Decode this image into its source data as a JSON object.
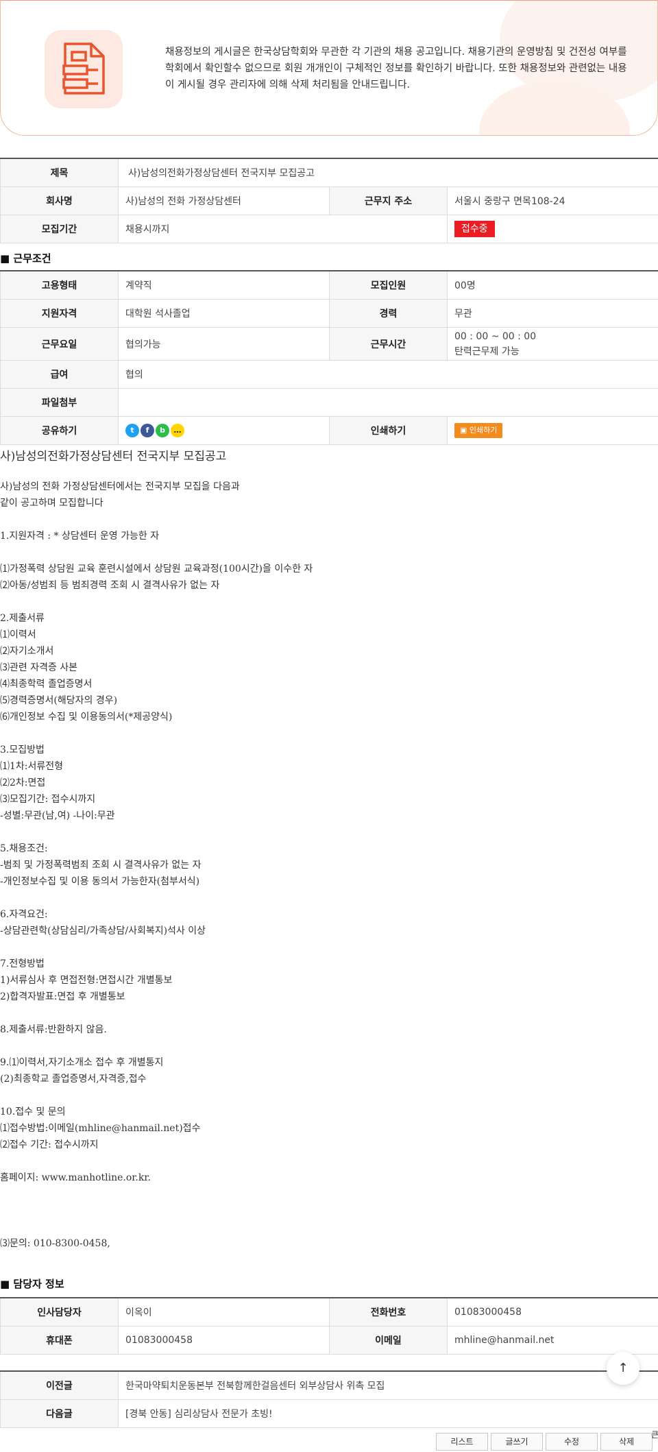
{
  "notice": {
    "text": "채용정보의 게시글은 한국상담학회와 무관한 각 기관의 채용 공고입니다. 채용기관의 운영방침 및 건전성 여부를 학회에서 확인할수 없으므로 회원 개개인이 구체적인 정보를 확인하기 바랍니다. 또한 채용정보와 관련없는 내용이 게시될 경우 관리자에 의해 삭제 처리됨을 안내드립니다.",
    "icon": "document-icon"
  },
  "info": {
    "title_label": "제목",
    "title_value": "사)남성의전화가정상담센터 전국지부 모집공고",
    "company_label": "회사명",
    "company_value": "사)남성의 전화 가정상담센터",
    "address_label": "근무지 주소",
    "address_value": "서울시 중랑구 면목108-24",
    "period_label": "모집기간",
    "period_value": "채용시까지",
    "status_badge": "접수중"
  },
  "conditions": {
    "heading": "■ 근무조건",
    "employment_label": "고용형태",
    "employment_value": "계약직",
    "headcount_label": "모집인원",
    "headcount_value": "00명",
    "qualification_label": "지원자격",
    "qualification_value": "대학원 석사졸업",
    "career_label": "경력",
    "career_value": "무관",
    "workday_label": "근무요일",
    "workday_value": "협의가능",
    "worktime_label": "근무시간",
    "worktime_value1": "00 : 00 ~ 00 : 00",
    "worktime_value2": "탄력근무제 가능",
    "salary_label": "급여",
    "salary_value": "협의",
    "attach_label": "파일첨부",
    "share_label": "공유하기",
    "print_label": "인쇄하기",
    "print_button": "인쇄하기",
    "share_icons": [
      "twitter-icon",
      "facebook-icon",
      "band-icon",
      "kakaotalk-icon"
    ]
  },
  "content": {
    "title": "사)남성의전화가정상담센터 전국지부 모집공고",
    "lines": [
      "사)남성의 전화 가정상담센터에서는 전국지부 모집을 다음과",
      "같이 공고하며 모집합니다",
      "",
      "1.지원자격 : * 상담센터 운영 가능한 자",
      "",
      "⑴가정폭력 상담원 교육 훈련시설에서 상담원 교육과정(100시간)을 이수한 자",
      "⑵아동/성범죄 등 범죄경력 조회 시 결격사유가 없는 자",
      "",
      "2.제출서류",
      "⑴이력서",
      "⑵자기소개서",
      "⑶관련 자격증 사본",
      "⑷최종학력 졸업증명서",
      "⑸경력증명서(해당자의 경우)",
      "⑹개인정보 수집 및 이용동의서(*제공양식)",
      "",
      "3.모집방법",
      "⑴1차:서류전형",
      "⑵2차:면접",
      "⑶모집기간: 접수시까지",
      "-성별:무관(남,여) -나이:무관",
      "",
      "5.채용조건:",
      "-범죄 및 가정폭력범죄 조회 시 결격사유가 없는 자",
      "-개인정보수집 및 이용 동의서 가능한자(첨부서식)",
      "",
      "6.자격요건:",
      "-상담관련학(상담심리/가족상담/사회복지)석사 이상",
      "",
      "7.전형방법",
      "1)서류심사 후 면접전형:면접시간 개별통보",
      "2)합격자발표:면접 후 개별통보",
      "",
      "8.제출서류:반환하지 않음.",
      "",
      "9.⑴이력서,자기소개소 접수 후 개별통지",
      "(2)최종학교 졸업증명서,자격증,접수",
      "",
      "10.접수 및 문의",
      "⑴접수방법:이메일(mhline@hanmail.net)접수",
      "⑵접수 기간: 접수시까지",
      "",
      "홈페이지: www.manhotline.or.kr.",
      "",
      "",
      "",
      "⑶문의: 010-8300-0458,"
    ]
  },
  "manager": {
    "heading": "■ 담당자 정보",
    "hr_label": "인사담당자",
    "hr_value": "이옥이",
    "phone_label": "전화번호",
    "phone_value": "01083000458",
    "mobile_label": "휴대폰",
    "mobile_value": "01083000458",
    "email_label": "이메일",
    "email_value": "mhline@hanmail.net"
  },
  "nav": {
    "prev_label": "이전글",
    "prev_value": "한국마약퇴치운동본부 전북함께한걸음센터 외부상담사 위촉 모집",
    "next_label": "다음글",
    "next_value": "[경북 안동] 심리상담사 전문가 초빙!"
  },
  "buttons": {
    "list": "리스트",
    "write": "글쓰기",
    "edit": "수정",
    "delete": "삭제",
    "top": "↑",
    "edge_text": "큰"
  }
}
